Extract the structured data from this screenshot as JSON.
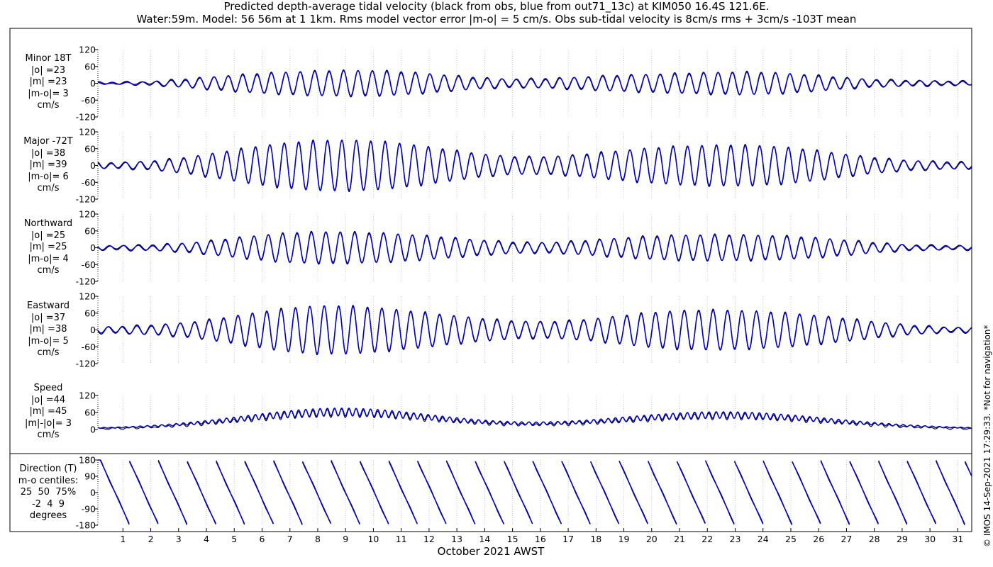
{
  "title_line1": "Predicted depth-average tidal velocity (black from obs, blue from out71_13c) at KIM050 16.4S 121.6E.",
  "title_line2": "Water:59m. Model: 56 56m at 1 1km. Rms model vector error |m-o| = 5 cm/s. Obs sub-tidal velocity is 8cm/s rms + 3cm/s -103T mean",
  "credit": "© IMOS 14-Sep-2021 17:29:33. *Not for navigation*",
  "chart_data": {
    "type": "line",
    "xlabel": "October 2021 AWST",
    "x_ticks": [
      "1",
      "2",
      "3",
      "4",
      "5",
      "6",
      "7",
      "8",
      "9",
      "10",
      "11",
      "12",
      "13",
      "14",
      "15",
      "16",
      "17",
      "18",
      "19",
      "20",
      "21",
      "22",
      "23",
      "24",
      "25",
      "26",
      "27",
      "28",
      "29",
      "30",
      "31"
    ],
    "x_range_days": [
      0.1,
      31.5
    ],
    "series_legend": {
      "obs": "black",
      "model": "blue"
    },
    "colors": {
      "obs": "#000000",
      "model": "#0000cc",
      "grid": "#c8c8c8"
    },
    "panels": [
      {
        "label": [
          "Minor 18T",
          "|o| =23",
          "|m| =23",
          "|m-o|= 3",
          "cm/s"
        ],
        "yticks": [
          "120",
          "60",
          "0",
          "-60",
          "-120"
        ],
        "ylim": [
          -120,
          120
        ],
        "kind": "velocity",
        "peak_amplitude_cm_s": [
          28,
          45,
          30,
          38
        ]
      },
      {
        "label": [
          "Major -72T",
          "|o| =38",
          "|m| =39",
          "|m-o|= 6",
          "cm/s"
        ],
        "yticks": [
          "120",
          "60",
          "0",
          "-60",
          "-120"
        ],
        "ylim": [
          -120,
          120
        ],
        "kind": "velocity",
        "peak_amplitude_cm_s": [
          80,
          88,
          75,
          70
        ]
      },
      {
        "label": [
          "Northward",
          "|o| =25",
          "|m| =25",
          "|m-o|= 4",
          "cm/s"
        ],
        "yticks": [
          "120",
          "60",
          "0",
          "-60",
          "-120"
        ],
        "ylim": [
          -120,
          120
        ],
        "kind": "velocity",
        "peak_amplitude_cm_s": [
          48,
          55,
          50,
          45
        ]
      },
      {
        "label": [
          "Eastward",
          "|o| =37",
          "|m| =38",
          "|m-o|= 5",
          "cm/s"
        ],
        "yticks": [
          "120",
          "60",
          "0",
          "-60",
          "-120"
        ],
        "ylim": [
          -120,
          120
        ],
        "kind": "velocity",
        "peak_amplitude_cm_s": [
          75,
          82,
          72,
          68
        ]
      },
      {
        "label": [
          "Speed",
          "|o| =44",
          "|m| =45",
          "|m|-|o|= 3",
          "cm/s"
        ],
        "yticks": [
          "120",
          "60",
          "0"
        ],
        "ylim": [
          0,
          120
        ],
        "kind": "speed",
        "peak_amplitude_cm_s": [
          70,
          85,
          60,
          70
        ]
      },
      {
        "label": [
          "Direction (T)",
          "m-o centiles:",
          "25  50  75%",
          "-2  4  9",
          "degrees"
        ],
        "yticks": [
          "180",
          "90",
          "0",
          "-90",
          "-180"
        ],
        "ylim": [
          -180,
          180
        ],
        "kind": "direction",
        "centiles": {
          "p25": -2,
          "p50": 4,
          "p75": 9
        }
      }
    ]
  }
}
